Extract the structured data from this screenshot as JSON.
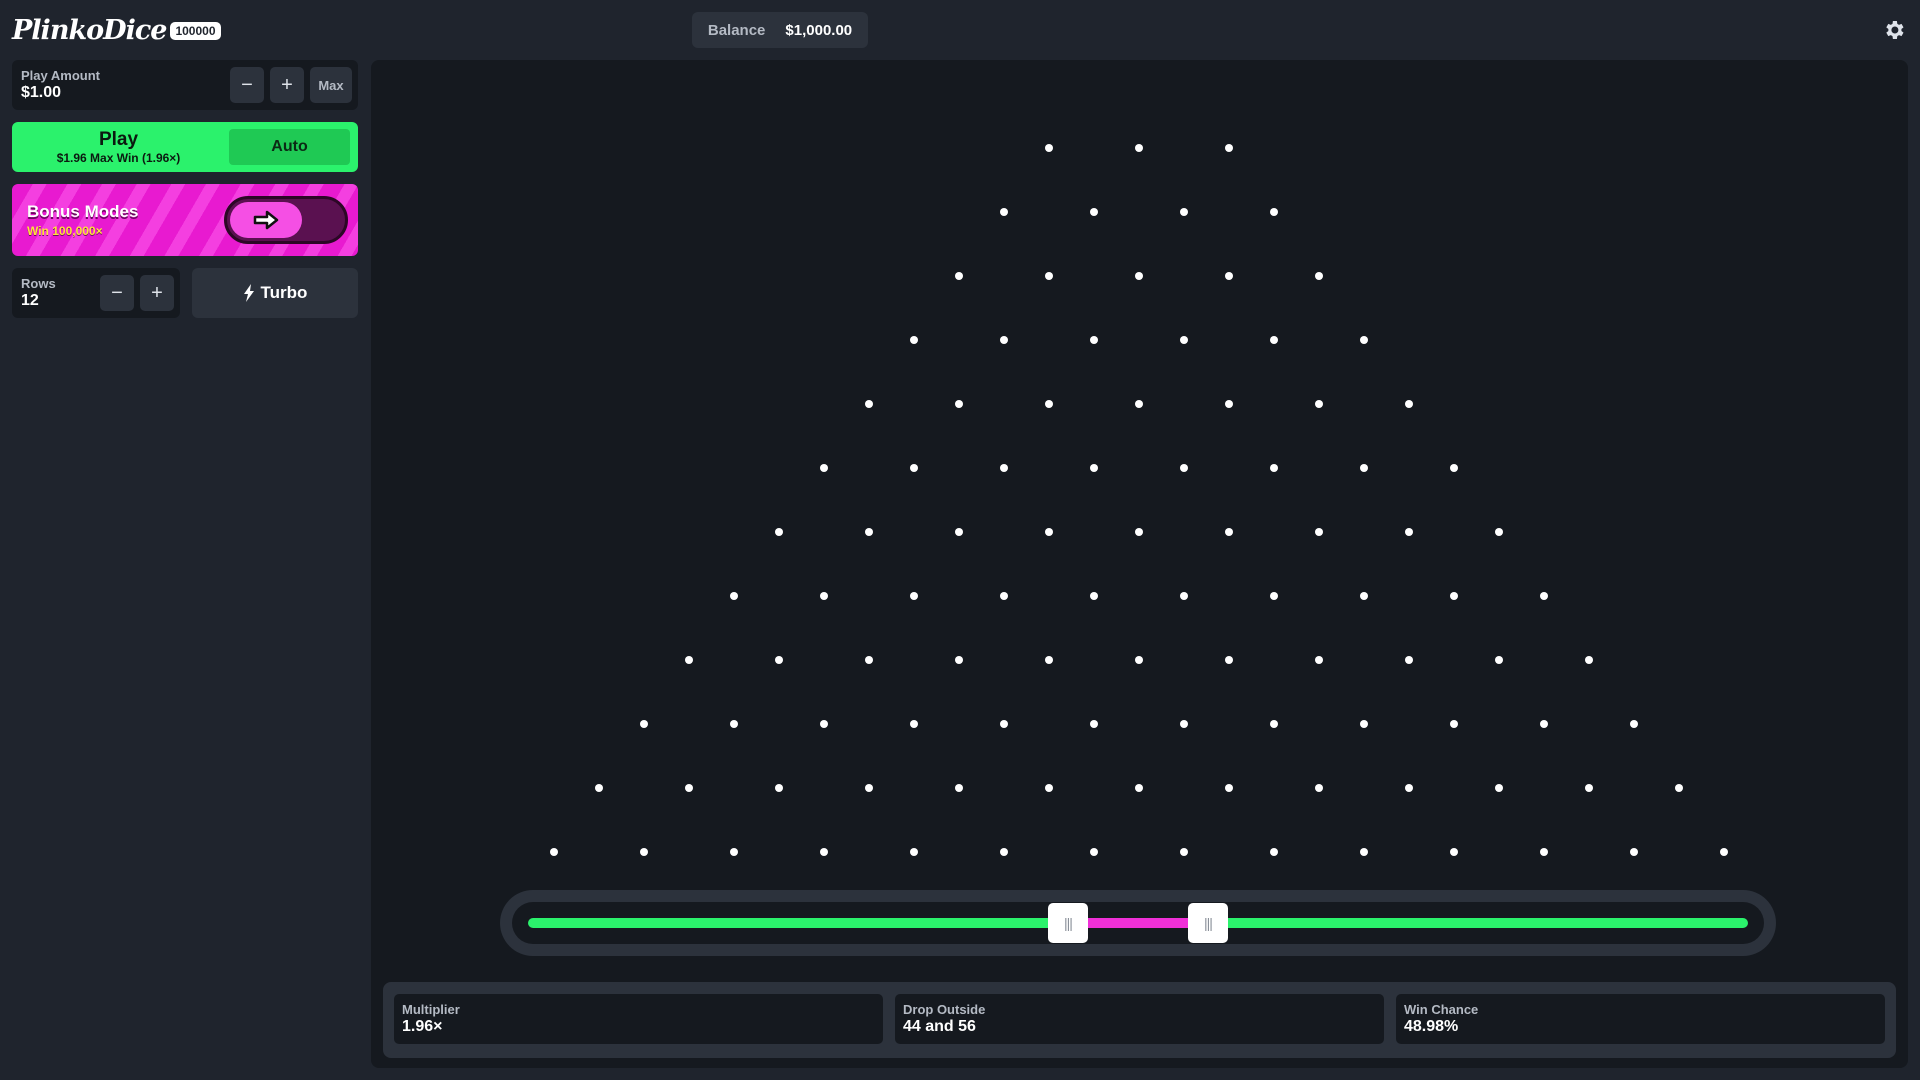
{
  "header": {
    "logo_text": "PlinkoDice",
    "logo_badge": "100000",
    "balance_label": "Balance",
    "balance_value": "$1,000.00",
    "settings_icon": "gear-icon"
  },
  "controls": {
    "play_amount": {
      "label": "Play Amount",
      "value": "$1.00",
      "minus": "−",
      "plus": "+",
      "max": "Max"
    },
    "play": {
      "label": "Play",
      "sub": "$1.96 Max Win (1.96×)",
      "auto": "Auto"
    },
    "bonus": {
      "title": "Bonus Modes",
      "sub": "Win 100,000×",
      "icon": "arrow-right-icon"
    },
    "rows": {
      "label": "Rows",
      "value": "12",
      "minus": "−",
      "plus": "+"
    },
    "turbo": {
      "label": "Turbo",
      "icon": "lightning-icon"
    }
  },
  "board": {
    "rows": 12,
    "first_row_pegs": 3
  },
  "slider": {
    "handle_low_label": "|||",
    "handle_high_label": "|||",
    "colors": {
      "outside": "#2bf26c",
      "inside": "#f030d8"
    }
  },
  "stats": [
    {
      "label": "Multiplier",
      "value": "1.96×"
    },
    {
      "label": "Drop Outside",
      "value": "44 and 56"
    },
    {
      "label": "Win Chance",
      "value": "48.98%"
    }
  ],
  "colors": {
    "background": "#1f242d",
    "panel": "#15191f",
    "accent_green": "#2bf26c",
    "accent_pink": "#e81ad0"
  }
}
